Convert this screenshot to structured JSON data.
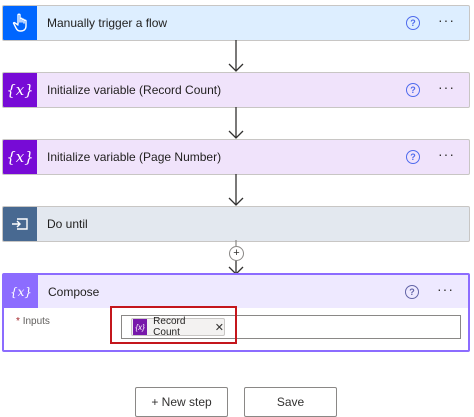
{
  "steps": [
    {
      "title": "Manually trigger a flow",
      "icon": "hand-touch-icon",
      "color": "#0066ff",
      "bg": "#ddeeff"
    },
    {
      "title": "Initialize variable (Record Count)",
      "icon": "variable-icon",
      "color": "#770bd6",
      "bg": "#f0e3fb"
    },
    {
      "title": "Initialize variable (Page Number)",
      "icon": "variable-icon",
      "color": "#770bd6",
      "bg": "#f0e3fb"
    },
    {
      "title": "Do until",
      "icon": "loop-icon",
      "color": "#486991",
      "bg": "#e3e8ef"
    }
  ],
  "compose": {
    "title": "Compose",
    "color": "#8c6cff",
    "bg": "#eee9ff",
    "inputs_required": "*",
    "inputs_label": "Inputs",
    "token_label": "Record Count",
    "token_icon_text": "{x}",
    "token_close": "✕"
  },
  "icons": {
    "variable_text": "{x}",
    "help": "?",
    "more": "···",
    "add": "+"
  },
  "buttons": {
    "new_step": "+ New step",
    "save": "Save"
  }
}
